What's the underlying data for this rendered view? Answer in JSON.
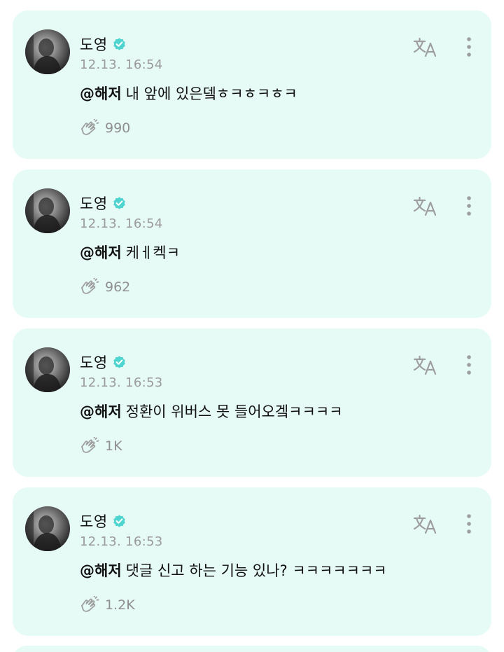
{
  "comments": [
    {
      "author": "도영",
      "timestamp": "12.13. 16:54",
      "mention": "@해저",
      "text": "내 앞에 있은뎈ㅎㅋㅎㅋㅎㅋ",
      "likes": "990"
    },
    {
      "author": "도영",
      "timestamp": "12.13. 16:54",
      "mention": "@해저",
      "text": "케ㅔ켁ㅋ",
      "likes": "962"
    },
    {
      "author": "도영",
      "timestamp": "12.13. 16:53",
      "mention": "@해저",
      "text": "정환이 위버스 못 들어오겤ㅋㅋㅋㅋ",
      "likes": "1K"
    },
    {
      "author": "도영",
      "timestamp": "12.13. 16:53",
      "mention": "@해저",
      "text": "댓글 신고 하는 기능 있나? ㅋㅋㅋㅋㅋㅋㅋ",
      "likes": "1.2K"
    }
  ],
  "icons": {
    "verified": "verified-badge-icon",
    "translate": "translate-icon",
    "more": "more-vertical-icon",
    "like": "like-hands-icon"
  },
  "colors": {
    "card_background": "#e6fbf6",
    "verified_badge": "#4fd4cf",
    "timestamp": "#9a9a9a",
    "icon_gray": "#9e9e9e"
  }
}
